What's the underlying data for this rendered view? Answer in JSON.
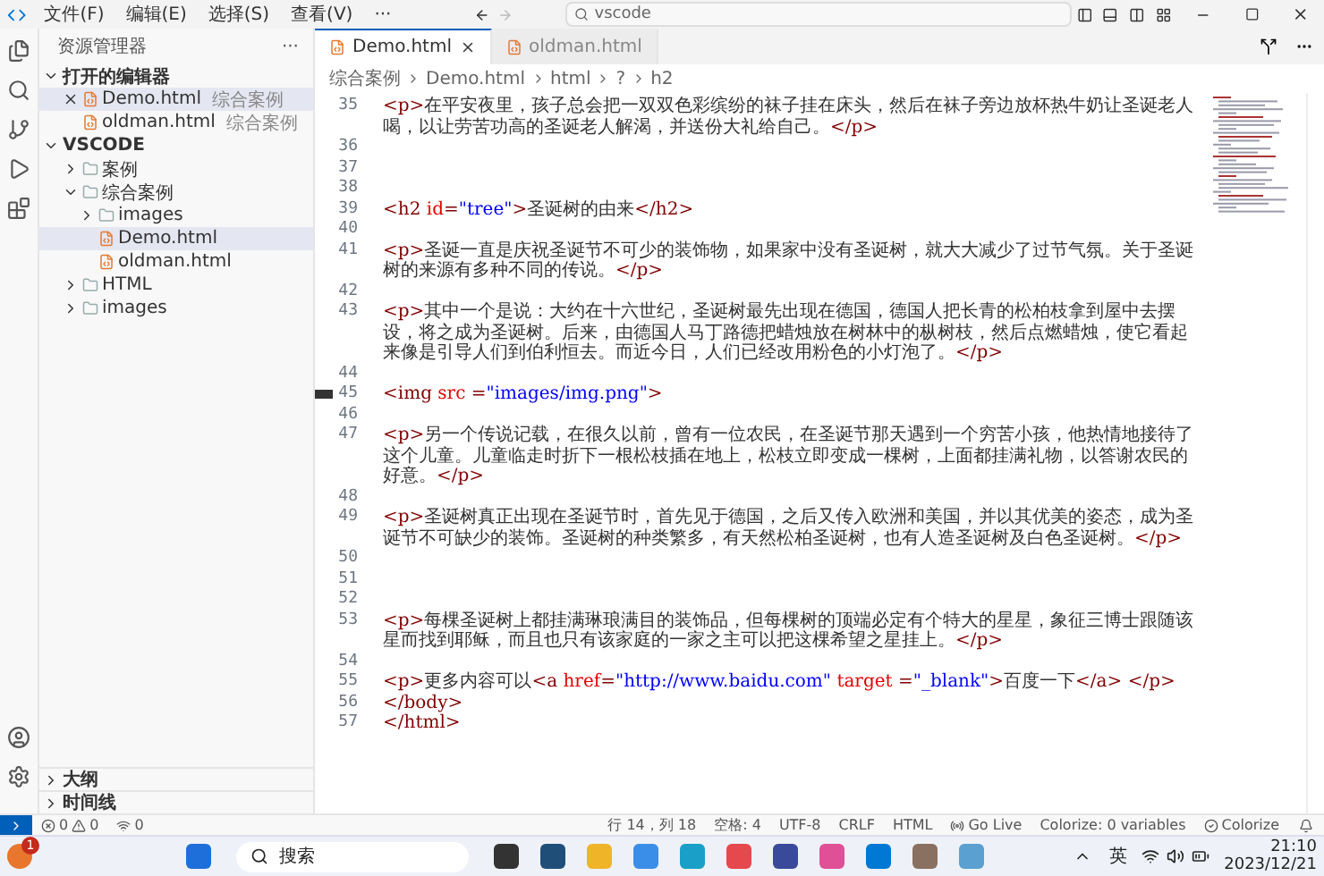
{
  "title_bar": {
    "menus": [
      "文件(F)",
      "编辑(E)",
      "选择(S)",
      "查看(V)",
      "···"
    ],
    "search": "vscode"
  },
  "sidebar": {
    "title": "资源管理器",
    "more": "···",
    "open_editors": {
      "title": "打开的编辑器",
      "expanded": true,
      "items": [
        {
          "name": "Demo.html",
          "folder": "综合案例",
          "selected": true
        },
        {
          "name": "oldman.html",
          "folder": "综合案例",
          "selected": false
        }
      ]
    },
    "workspace": {
      "title": "VSCODE",
      "expanded": true,
      "children": [
        {
          "name": "案例",
          "kind": "folder",
          "expanded": false,
          "selected": false
        },
        {
          "name": "综合案例",
          "kind": "folder",
          "expanded": true,
          "selected": false,
          "children": [
            {
              "name": "images",
              "kind": "folder",
              "expanded": false,
              "selected": false
            },
            {
              "name": "Demo.html",
              "kind": "file",
              "selected": true
            },
            {
              "name": "oldman.html",
              "kind": "file",
              "selected": false
            }
          ]
        },
        {
          "name": "HTML",
          "kind": "folder",
          "expanded": false,
          "selected": false
        },
        {
          "name": "images",
          "kind": "folder",
          "expanded": false,
          "selected": false
        }
      ]
    },
    "sections": [
      {
        "title": "大纲",
        "expanded": false
      },
      {
        "title": "时间线",
        "expanded": false
      }
    ]
  },
  "tabs": [
    {
      "label": "Demo.html",
      "selected": true
    },
    {
      "label": "oldman.html",
      "selected": false
    }
  ],
  "breadcrumb": [
    "综合案例",
    "Demo.html",
    "html",
    "?",
    "h2"
  ],
  "editor": {
    "lines": [
      {
        "number": "35",
        "code": "<p>在平安夜里，孩子总会把一双双色彩缤纷的袜子挂在床头，然后在袜子旁边放杯热牛奶让圣诞老人喝，以让劳苦功高的圣诞老人解渴，并送份大礼给自己。</p>",
        "marked": false
      },
      {
        "number": "36",
        "marked": false
      },
      {
        "number": "37",
        "marked": false
      },
      {
        "number": "38",
        "marked": false
      },
      {
        "number": "39",
        "code": "<h2 id=\"tree\">圣诞树的由来</h2>",
        "marked": false
      },
      {
        "number": "40",
        "marked": false
      },
      {
        "number": "41",
        "code": "<p>圣诞一直是庆祝圣诞节不可少的装饰物，如果家中没有圣诞树，就大大减少了过节气氛。关于圣诞树的来源有多种不同的传说。</p>",
        "marked": false
      },
      {
        "number": "42",
        "marked": false
      },
      {
        "number": "43",
        "code": "<p>其中一个是说：大约在十六世纪，圣诞树最先出现在德国，德国人把长青的松柏枝拿到屋中去摆设，将之成为圣诞树。后来，由德国人马丁路德把蜡烛放在树林中的枞树枝，然后点燃蜡烛，使它看起来像是引导人们到伯利恒去。而近今日，人们已经改用粉色的小灯泡了。</p>",
        "marked": false
      },
      {
        "number": "44",
        "marked": false
      },
      {
        "number": "45",
        "code": "<img src =\"images/img.png\">",
        "marked": true
      },
      {
        "number": "46",
        "marked": false
      },
      {
        "number": "47",
        "code": "<p>另一个传说记载，在很久以前，曾有一位农民，在圣诞节那天遇到一个穷苦小孩，他热情地接待了这个儿童。儿童临走时折下一根松枝插在地上，松枝立即变成一棵树，上面都挂满礼物，以答谢农民的好意。</p>",
        "marked": false
      },
      {
        "number": "48",
        "marked": false
      },
      {
        "number": "49",
        "code": "<p>圣诞树真正出现在圣诞节时，首先见于德国，之后又传入欧洲和美国，并以其优美的姿态，成为圣诞节不可缺少的装饰。圣诞树的种类繁多，有天然松柏圣诞树，也有人造圣诞树及白色圣诞树。</p>",
        "marked": false
      },
      {
        "number": "50",
        "marked": false
      },
      {
        "number": "51",
        "marked": false
      },
      {
        "number": "52",
        "marked": false
      },
      {
        "number": "53",
        "code": "<p>每棵圣诞树上都挂满琳琅满目的装饰品，但每棵树的顶端必定有个特大的星星，象征三博士跟随该星而找到耶稣，而且也只有该家庭的一家之主可以把这棵希望之星挂上。</p>",
        "marked": false
      },
      {
        "number": "54",
        "marked": false
      },
      {
        "number": "55",
        "code": "<p>更多内容可以<a href=\"http://www.baidu.com\" target =\"_blank\">百度一下</a>  </p>",
        "marked": false
      },
      {
        "number": "56",
        "code": "</body>",
        "marked": false
      },
      {
        "number": "57",
        "code": "</html>",
        "marked": false
      }
    ]
  },
  "status_bar": {
    "errors": "0",
    "warnings": "0",
    "ports": "0",
    "items": [
      {
        "text": "行 14，列 18",
        "kind": "plain"
      },
      {
        "text": "空格: 4",
        "kind": "plain"
      },
      {
        "text": "UTF-8",
        "kind": "plain"
      },
      {
        "text": "CRLF",
        "kind": "plain"
      },
      {
        "text": "HTML",
        "kind": "plain"
      },
      {
        "text": "Go Live",
        "kind": "broadcast"
      },
      {
        "text": "Colorize: 0 variables",
        "kind": "plain"
      },
      {
        "text": "Colorize",
        "kind": "check"
      }
    ]
  },
  "taskbar": {
    "badge": "1",
    "search": "搜索",
    "ime": "英",
    "time": "21:10",
    "date": "2023/12/21"
  }
}
